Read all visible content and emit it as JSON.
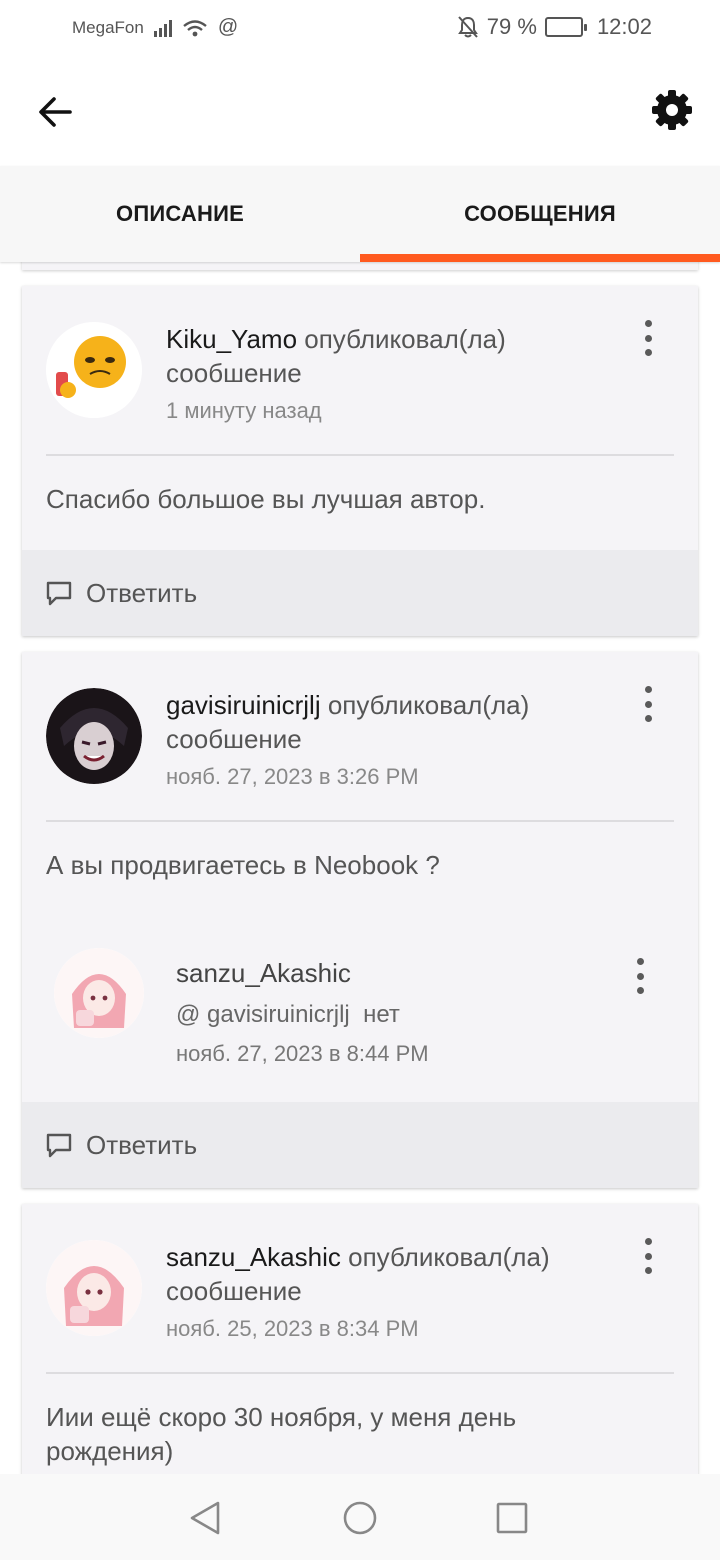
{
  "status_bar": {
    "carrier": "MegaFon",
    "network_symbol": "@",
    "battery": "79 %",
    "battery_level": 0.79,
    "time": "12:02",
    "icons": [
      "signal-icon",
      "wifi-icon",
      "mute-bell-icon",
      "battery-icon"
    ]
  },
  "app_bar": {
    "back_icon": "arrow-left-icon",
    "settings_icon": "gear-icon"
  },
  "tabs": [
    {
      "label": "ОПИСАНИЕ",
      "active": false
    },
    {
      "label": "СООБЩЕНИЯ",
      "active": true
    }
  ],
  "accent_color": "#ff5a1f",
  "posts": [
    {
      "username": "Kiku_Yamo",
      "action": "опубликовал(ла)",
      "object": "сообшение",
      "time": "1 минуту назад",
      "text": "Спасибо большое вы лучшая автор.",
      "reply_label": "Ответить"
    },
    {
      "username": "gavisiruinicrjlj",
      "action": "опубликовал(ла)",
      "object": "сообшение",
      "time": "нояб. 27, 2023 в 3:26 PM",
      "text": "А вы продвигаетесь в Neobook ?",
      "reply": {
        "username": "sanzu_Akashic",
        "mention": "@ gavisiruinicrjlj",
        "text": "нет",
        "time": "нояб. 27, 2023 в 8:44 PM"
      },
      "reply_label": "Ответить"
    },
    {
      "username": "sanzu_Akashic",
      "action": "опубликовал(ла)",
      "object": "сообшение",
      "time": "нояб. 25, 2023 в 8:34 PM",
      "text_line1": "Иии ещё скоро 30 ноября, у меня день",
      "text_line2": "рождения)"
    }
  ],
  "nav_bar": {
    "icons": [
      "back-triangle-icon",
      "home-circle-icon",
      "recents-square-icon"
    ]
  }
}
